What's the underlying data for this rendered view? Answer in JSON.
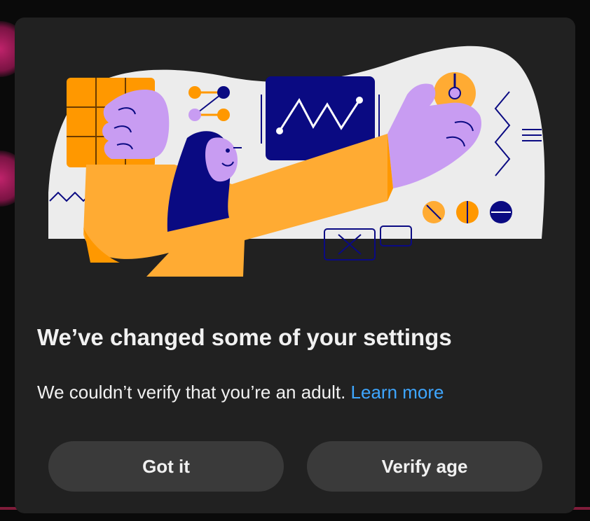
{
  "dialog": {
    "title": "We’ve changed some of your settings",
    "message": "We couldn’t verify that you’re an adult.",
    "learn_more": "Learn more",
    "buttons": {
      "got_it": "Got it",
      "verify_age": "Verify age"
    }
  },
  "colors": {
    "dialog_bg": "#212121",
    "button_bg": "#3a3a3a",
    "text": "#f1f1f1",
    "link": "#3ea6ff",
    "illus_bg": "#ececec",
    "orange": "#ff9800",
    "light_orange": "#ffab33",
    "purple": "#c89cf2",
    "navy": "#0a0a82"
  },
  "icons": {
    "illustration": "settings-illustration"
  }
}
